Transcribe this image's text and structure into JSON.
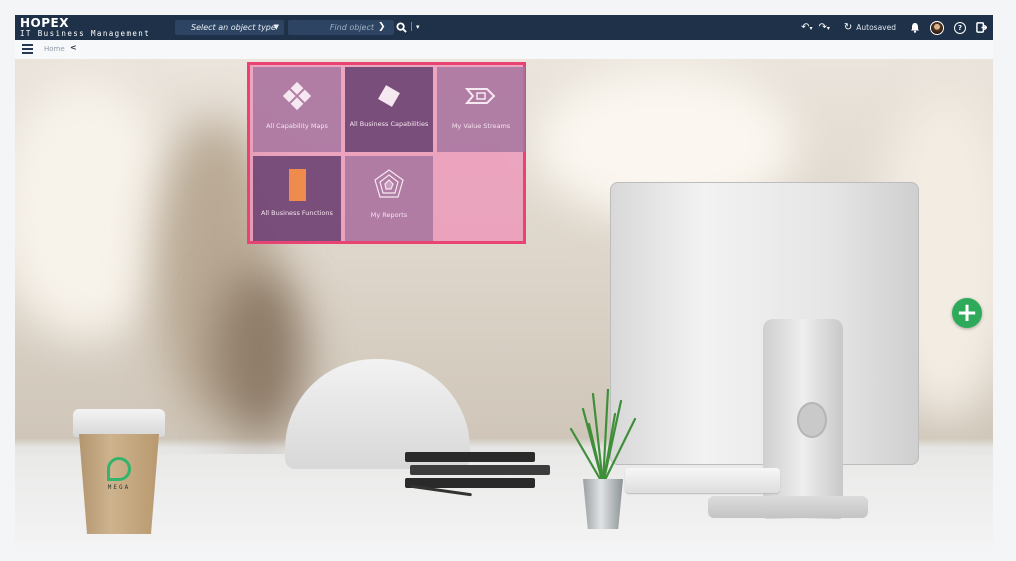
{
  "app": {
    "name": "HOPEX",
    "subtitle": "IT Business Management"
  },
  "header": {
    "object_type_placeholder": "Select an object type",
    "find_placeholder": "Find object",
    "autosave_label": "Autosaved",
    "icons": [
      "search-icon",
      "chevron-down-icon",
      "undo-icon",
      "redo-icon",
      "sync-icon",
      "bell-icon",
      "avatar",
      "help-icon",
      "logout-icon"
    ]
  },
  "breadcrumb": {
    "home": "Home",
    "back_glyph": "<"
  },
  "tiles": [
    {
      "label": "All Capability Maps",
      "icon": "diamond-grid-icon",
      "shade": "light"
    },
    {
      "label": "All Business Capabilities",
      "icon": "diamond-icon",
      "shade": "dark"
    },
    {
      "label": "My Value Streams",
      "icon": "value-stream-icon",
      "shade": "light"
    },
    {
      "label": "All Business Functions",
      "icon": "function-block-icon",
      "shade": "dark"
    },
    {
      "label": "My Reports",
      "icon": "radar-chart-icon",
      "shade": "light"
    }
  ],
  "cup_logo_text": "MEGA",
  "colors": {
    "topbar": "#1e3148",
    "highlight_border": "#e84372",
    "fab": "#2eaa5a",
    "function_block": "#f08b4e"
  },
  "fab_glyph": "+"
}
